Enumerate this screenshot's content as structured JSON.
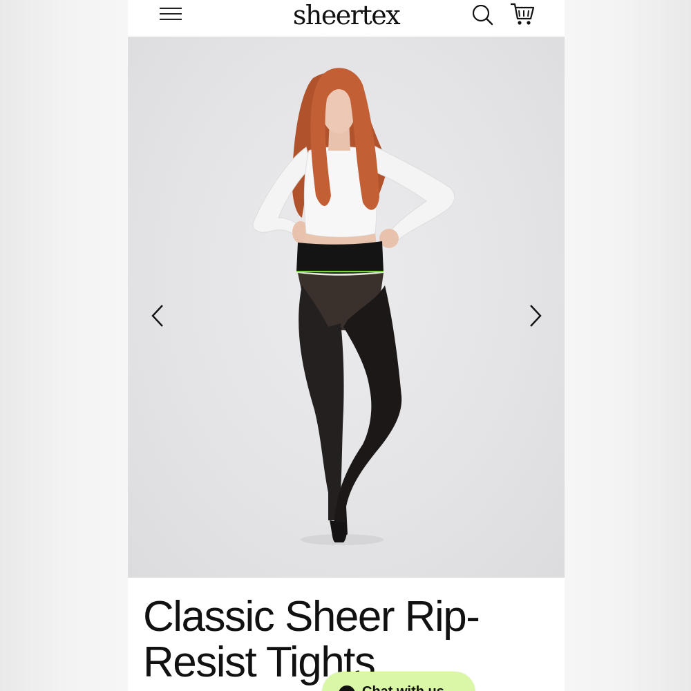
{
  "header": {
    "logo": "sheertex",
    "menu_icon": "hamburger-menu-icon",
    "search_icon": "search-icon",
    "cart_icon": "cart-icon"
  },
  "gallery": {
    "image_subject": "model wearing black sheer tights and white crop top",
    "prev_icon": "chevron-left-icon",
    "next_icon": "chevron-right-icon"
  },
  "product": {
    "title": "Classic Sheer Rip-Resist Tights"
  },
  "chat": {
    "label": "Chat with us",
    "color": "#d9f7a6"
  },
  "colors": {
    "accent_green": "#7bd339",
    "background": "#ffffff",
    "text": "#111111"
  }
}
